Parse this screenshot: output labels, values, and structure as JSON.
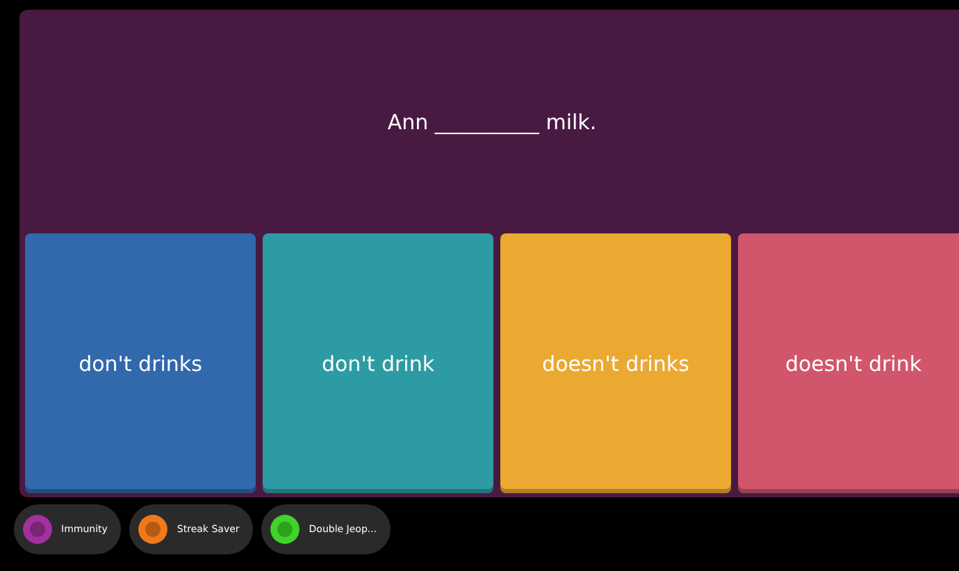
{
  "question": "Ann __________ milk.",
  "options": [
    {
      "label": "don't drinks",
      "color": "#3169ac"
    },
    {
      "label": "don't drink",
      "color": "#2d9ba3"
    },
    {
      "label": "doesn't drinks",
      "color": "#eba931"
    },
    {
      "label": "doesn't drink",
      "color": "#d1566b"
    }
  ],
  "powerups": [
    {
      "label": "Immunity",
      "color": "#a3309f"
    },
    {
      "label": "Streak Saver",
      "color": "#f07a1a"
    },
    {
      "label": "Double Jeop...",
      "color": "#3fd42a"
    }
  ]
}
